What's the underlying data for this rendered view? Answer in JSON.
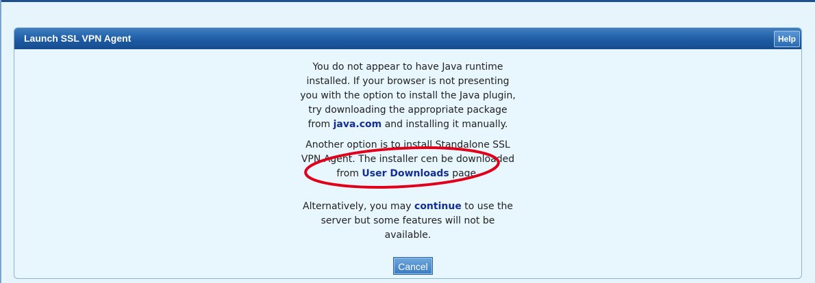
{
  "panel": {
    "title": "Launch SSL VPN Agent",
    "help_label": "Help"
  },
  "message1": {
    "line1": "You do not appear to have Java runtime",
    "line2": "installed. If your browser is not presenting",
    "line3": "you with the option to install the Java plugin,",
    "line4": "try downloading the appropriate package",
    "line5_prefix": "from ",
    "line5_link": "java.com",
    "line5_suffix": " and installing it manually."
  },
  "message2": {
    "line1": "Another option is to install Standalone SSL",
    "line2": "VPN Agent. The installer cen be downloaded",
    "line3_prefix": "from ",
    "line3_link": "User Downloads",
    "line3_suffix": " page."
  },
  "message3": {
    "line1_prefix": "Alternatively, you may ",
    "line1_link": "continue",
    "line1_suffix": " to use the",
    "line2": "server but some features will not be",
    "line3": "available."
  },
  "cancel_label": "Cancel",
  "colors": {
    "header_blue": "#1d5ba3",
    "link_blue": "#142f8f",
    "annotation_red": "#e0001a",
    "page_background": "#e6f5fc"
  }
}
